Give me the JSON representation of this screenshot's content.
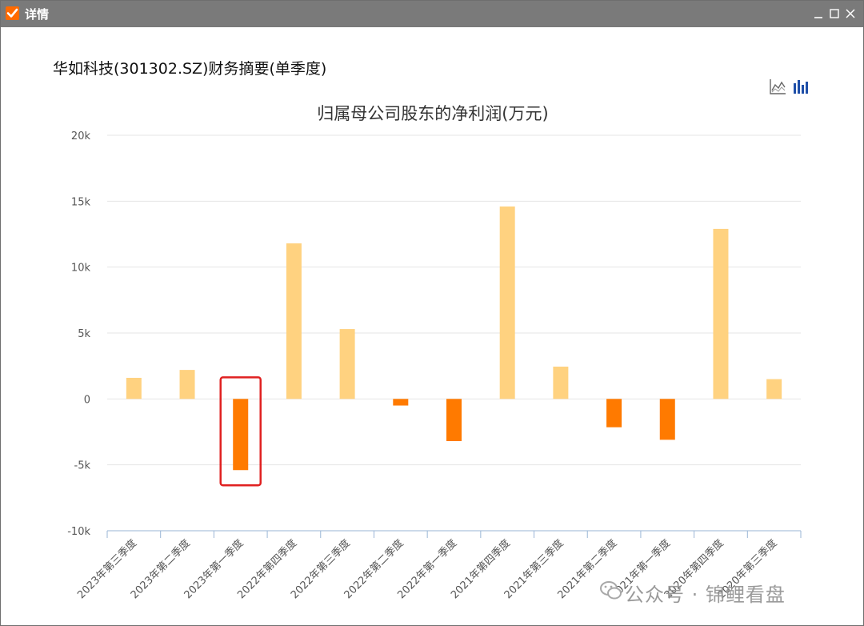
{
  "window": {
    "title": "详情",
    "icons": [
      "check-icon",
      "minimize-icon",
      "maximize-icon",
      "close-icon"
    ]
  },
  "header": {
    "subtitle": "华如科技(301302.SZ)财务摘要(单季度)"
  },
  "toolbar": {
    "icons": [
      "line-chart-icon",
      "bar-chart-icon"
    ]
  },
  "colors": {
    "positive_bar": "#ffd280",
    "negative_bar": "#ff7a00",
    "highlight_box": "#e02020",
    "grid": "#e6e6e6",
    "axis": "#9ab6d6"
  },
  "chart_data": {
    "type": "bar",
    "title": "归属母公司股东的净利润(万元)",
    "xlabel": "",
    "ylabel": "",
    "ylim": [
      -10000,
      20000
    ],
    "yticks": [
      {
        "value": 20000,
        "label": "20k"
      },
      {
        "value": 15000,
        "label": "15k"
      },
      {
        "value": 10000,
        "label": "10k"
      },
      {
        "value": 5000,
        "label": "5k"
      },
      {
        "value": 0,
        "label": "0"
      },
      {
        "value": -5000,
        "label": "-5k"
      },
      {
        "value": -10000,
        "label": "-10k"
      }
    ],
    "grid": true,
    "categories": [
      "2023年第三季度",
      "2023年第二季度",
      "2023年第一季度",
      "2022年第四季度",
      "2022年第三季度",
      "2022年第二季度",
      "2022年第一季度",
      "2021年第四季度",
      "2021年第三季度",
      "2021年第二季度",
      "2021年第一季度",
      "2020年第四季度",
      "2020年第三季度"
    ],
    "values": [
      1600,
      2200,
      -5400,
      11800,
      5300,
      -500,
      -3200,
      14600,
      2450,
      -2150,
      -3100,
      12900,
      1500
    ],
    "highlighted_category": "2023年第一季度"
  },
  "watermark": {
    "text": "公众号 · 锦鲤看盘",
    "icon": "wechat-icon"
  }
}
